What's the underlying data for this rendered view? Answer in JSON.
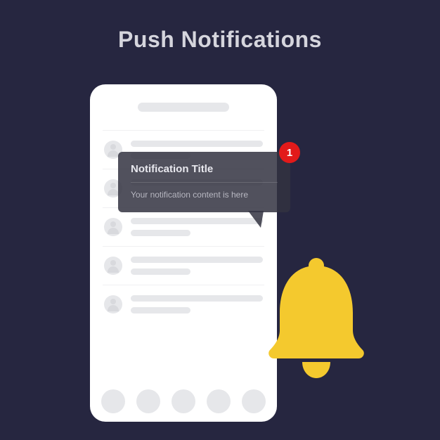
{
  "header": {
    "title": "Push Notifications"
  },
  "notification": {
    "title": "Notification Title",
    "body": "Your notification content is here",
    "badge_count": "1"
  },
  "colors": {
    "background": "#262640",
    "bell": "#f4c92e",
    "badge": "#e21a1a"
  }
}
